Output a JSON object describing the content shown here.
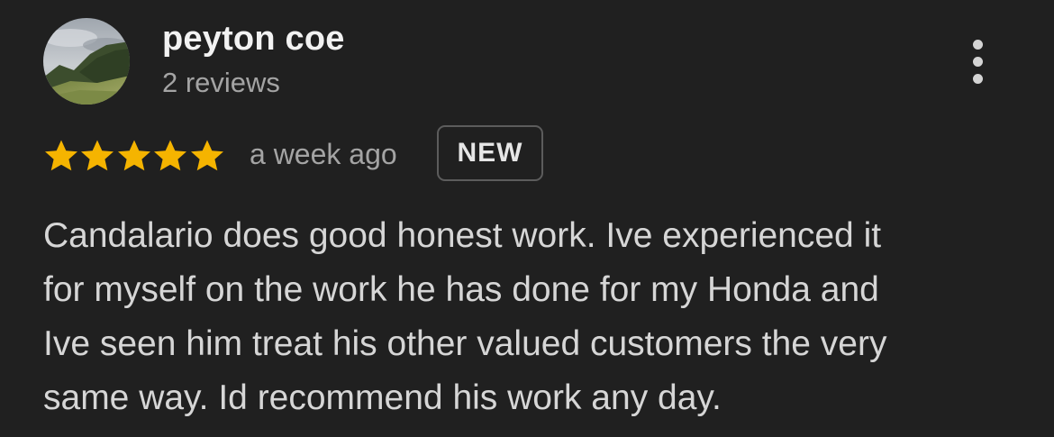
{
  "review": {
    "author": {
      "name": "peyton coe",
      "reviews_count": "2 reviews",
      "avatar": "mountain-landscape-photo"
    },
    "rating": 5,
    "rating_max": 5,
    "time": "a week ago",
    "badge": "NEW",
    "text_lines": [
      "Candalario does good honest work. Ive experienced it",
      "for myself on the work he has done for my Honda and",
      "Ive seen him treat his other valued customers the very",
      "same way. Id recommend his work any day."
    ]
  },
  "icons": {
    "menu": "more-vertical-icon",
    "star": "star-icon"
  },
  "colors": {
    "background": "#202020",
    "star": "#F5B400",
    "name": "#F2F2F2",
    "muted": "#A4A4A4",
    "body_text": "#D6D6D6",
    "badge_border": "#5C5C5C"
  }
}
